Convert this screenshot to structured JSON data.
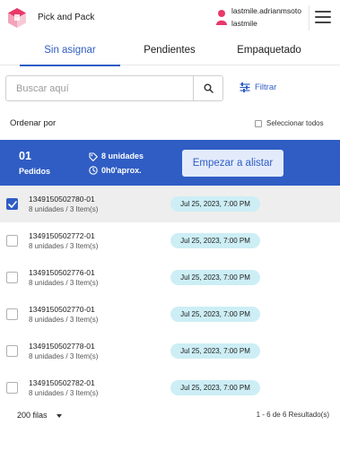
{
  "header": {
    "app_title": "Pick and Pack",
    "user_name": "lastmile.adrianmsoto",
    "user_role": "lastmile",
    "logo_icon": "package-logo-icon",
    "user_icon": "user-icon",
    "menu_icon": "hamburger-menu-icon"
  },
  "tabs": [
    {
      "label": "Sin asignar",
      "active": true
    },
    {
      "label": "Pendientes",
      "active": false
    },
    {
      "label": "Empaquetado",
      "active": false
    }
  ],
  "search": {
    "placeholder": "Buscar aquí",
    "value": "",
    "filter_label": "Filtrar"
  },
  "sort": {
    "label": "Ordenar por",
    "select_all_label": "Seleccionar todos",
    "select_all_checked": false
  },
  "summary": {
    "count": "01",
    "count_label": "Pedidos",
    "units": "8 unidades",
    "time": "0h0'aprox.",
    "action_label": "Empezar a alistar"
  },
  "orders": [
    {
      "id": "1349150502780-01",
      "detail": "8 unidades / 3 Item(s)",
      "date": "Jul 25, 2023, 7:00 PM",
      "selected": true
    },
    {
      "id": "1349150502772-01",
      "detail": "8 unidades / 3 Item(s)",
      "date": "Jul 25, 2023, 7:00 PM",
      "selected": false
    },
    {
      "id": "1349150502776-01",
      "detail": "8 unidades / 3 Item(s)",
      "date": "Jul 25, 2023, 7:00 PM",
      "selected": false
    },
    {
      "id": "1349150502770-01",
      "detail": "8 unidades / 3 Item(s)",
      "date": "Jul 25, 2023, 7:00 PM",
      "selected": false
    },
    {
      "id": "1349150502778-01",
      "detail": "8 unidades / 3 Item(s)",
      "date": "Jul 25, 2023, 7:00 PM",
      "selected": false
    },
    {
      "id": "1349150502782-01",
      "detail": "8 unidades / 3 Item(s)",
      "date": "Jul 25, 2023, 7:00 PM",
      "selected": false
    }
  ],
  "footer": {
    "rows_per_page": "200 filas",
    "result_count": "1 - 6 de 6 Resultado(s)"
  },
  "colors": {
    "accent": "#2f5dc4",
    "date_badge": "#cdeef5",
    "selected_row": "#eeeeee",
    "logo_pink": "#e8396a"
  }
}
